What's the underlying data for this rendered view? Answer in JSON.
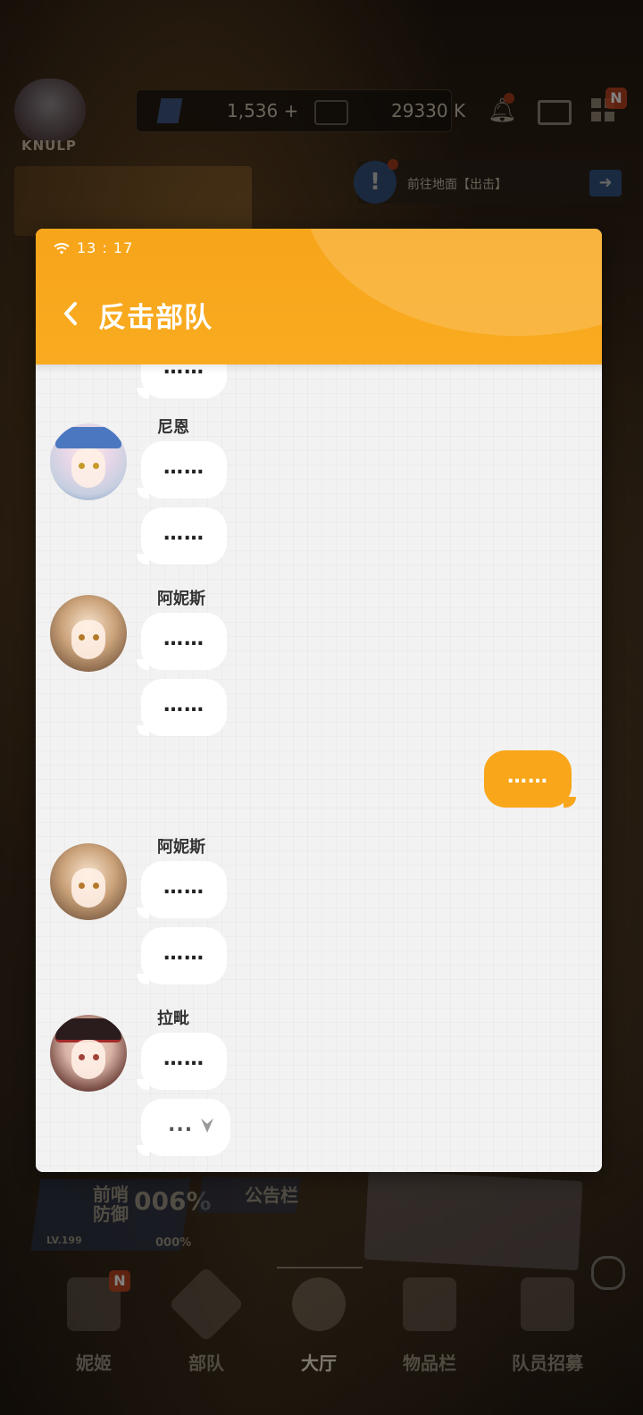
{
  "top_bar": {
    "player_name": "KNULP",
    "gems": "1,536",
    "gems_add": "+",
    "credits": "29330 K",
    "menu_badge": "N"
  },
  "mission": {
    "text": "前往地面【出击】",
    "alert": "!"
  },
  "status_bar": {
    "time": "13 : 17"
  },
  "chat": {
    "title": "反击部队",
    "partial_bubble": "……",
    "groups": [
      {
        "sender": "尼恩",
        "messages": [
          "……",
          "……"
        ]
      },
      {
        "sender": "阿妮斯",
        "messages": [
          "……",
          "……"
        ]
      },
      {
        "sender": "me",
        "messages": [
          "……"
        ]
      },
      {
        "sender": "阿妮斯",
        "messages": [
          "……",
          "……"
        ]
      },
      {
        "sender": "拉毗",
        "messages": [
          "……",
          "..."
        ]
      }
    ]
  },
  "background_widgets": {
    "sentry": "前哨\n防御",
    "sentry_pct": "006%",
    "notice": "公告栏",
    "level": "LV.199",
    "progress": "000%"
  },
  "bottom_nav": {
    "items": [
      {
        "label": "妮姬",
        "badge": "N"
      },
      {
        "label": "部队"
      },
      {
        "label": "大厅",
        "active": true
      },
      {
        "label": "物品栏"
      },
      {
        "label": "队员招募"
      }
    ]
  },
  "colors": {
    "accent": "#f9a61a",
    "bubble_in": "#ffffff",
    "bubble_out": "#f9a61a",
    "chat_bg": "#f2f2f2"
  }
}
